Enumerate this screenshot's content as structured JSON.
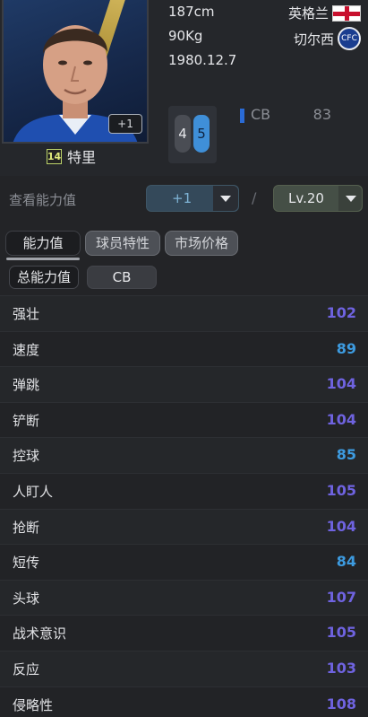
{
  "player": {
    "name": "特里",
    "number": "14",
    "plus_badge": "+1",
    "height": "187cm",
    "weight": "90Kg",
    "birthday": "1980.12.7",
    "nationality": "英格兰",
    "club": "切尔西",
    "weak_foot": "4",
    "strong_foot": "5",
    "position": "CB",
    "overall": "83"
  },
  "view": {
    "label": "查看能力值",
    "plus_value": "+1",
    "separator": "/",
    "level_value": "Lv.20"
  },
  "tabs": [
    {
      "label": "能力值"
    },
    {
      "label": "球员特性"
    },
    {
      "label": "市场价格"
    }
  ],
  "sub_tabs": [
    {
      "label": "总能力值"
    },
    {
      "label": "CB"
    }
  ],
  "stats": [
    {
      "name": "强壮",
      "value": "102",
      "color": "#6f63e0"
    },
    {
      "name": "速度",
      "value": "89",
      "color": "#3d9be0"
    },
    {
      "name": "弹跳",
      "value": "104",
      "color": "#6f63e0"
    },
    {
      "name": "铲断",
      "value": "104",
      "color": "#6f63e0"
    },
    {
      "name": "控球",
      "value": "85",
      "color": "#3d9be0"
    },
    {
      "name": "人盯人",
      "value": "105",
      "color": "#6f63e0"
    },
    {
      "name": "抢断",
      "value": "104",
      "color": "#6f63e0"
    },
    {
      "name": "短传",
      "value": "84",
      "color": "#3d9be0"
    },
    {
      "name": "头球",
      "value": "107",
      "color": "#6f63e0"
    },
    {
      "name": "战术意识",
      "value": "105",
      "color": "#6f63e0"
    },
    {
      "name": "反应",
      "value": "103",
      "color": "#6f63e0"
    },
    {
      "name": "侵略性",
      "value": "108",
      "color": "#6f63e0"
    }
  ],
  "icons": {
    "flag": "england-flag-icon",
    "club": "chelsea-crest-icon",
    "dropdown": "chevron-down-icon"
  }
}
